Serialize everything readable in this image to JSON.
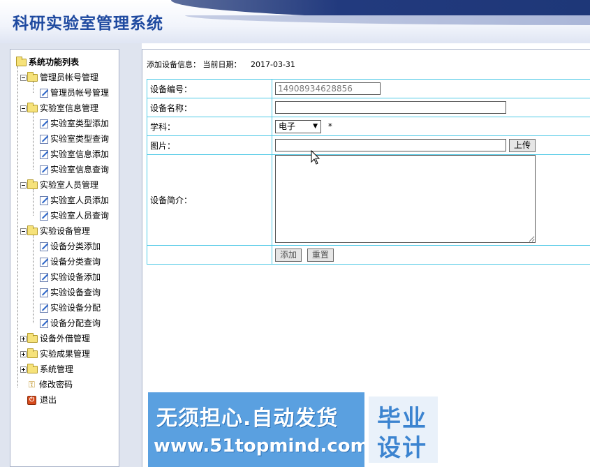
{
  "app": {
    "title": "科研实验室管理系统"
  },
  "sidebar": {
    "root_label": "系统功能列表",
    "groups": [
      {
        "label": "管理员帐号管理",
        "expanded": true,
        "items": [
          "管理员帐号管理"
        ]
      },
      {
        "label": "实验室信息管理",
        "expanded": true,
        "items": [
          "实验室类型添加",
          "实验室类型查询",
          "实验室信息添加",
          "实验室信息查询"
        ]
      },
      {
        "label": "实验室人员管理",
        "expanded": true,
        "items": [
          "实验室人员添加",
          "实验室人员查询"
        ]
      },
      {
        "label": "实验设备管理",
        "expanded": true,
        "items": [
          "设备分类添加",
          "设备分类查询",
          "实验设备添加",
          "实验设备查询",
          "实验设备分配",
          "设备分配查询"
        ]
      },
      {
        "label": "设备外借管理",
        "expanded": false,
        "items": []
      },
      {
        "label": "实验成果管理",
        "expanded": false,
        "items": []
      },
      {
        "label": "系统管理",
        "expanded": false,
        "items": []
      }
    ],
    "change_password": "修改密码",
    "exit": "退出"
  },
  "main": {
    "info_label": "添加设备信息：",
    "date_label": "当前日期：",
    "date_value": "2017-03-31",
    "form": {
      "id_label": "设备编号：",
      "id_value": "14908934628856",
      "name_label": "设备名称：",
      "name_value": "",
      "subject_label": "学科：",
      "subject_selected": "电子",
      "required_mark": "*",
      "image_label": "图片：",
      "image_value": "",
      "upload_button": "上传",
      "intro_label": "设备简介：",
      "intro_value": "",
      "submit_button": "添加",
      "reset_button": "重置"
    }
  },
  "watermark": {
    "line1": "无须担心.自动发货",
    "line2": "www.51topmind.com",
    "badge_line1": "毕业",
    "badge_line2": "设计"
  },
  "colors": {
    "title": "#1f4aa0",
    "table_border": "#4fc9e6",
    "watermark_blue": "#5aa0e0"
  }
}
